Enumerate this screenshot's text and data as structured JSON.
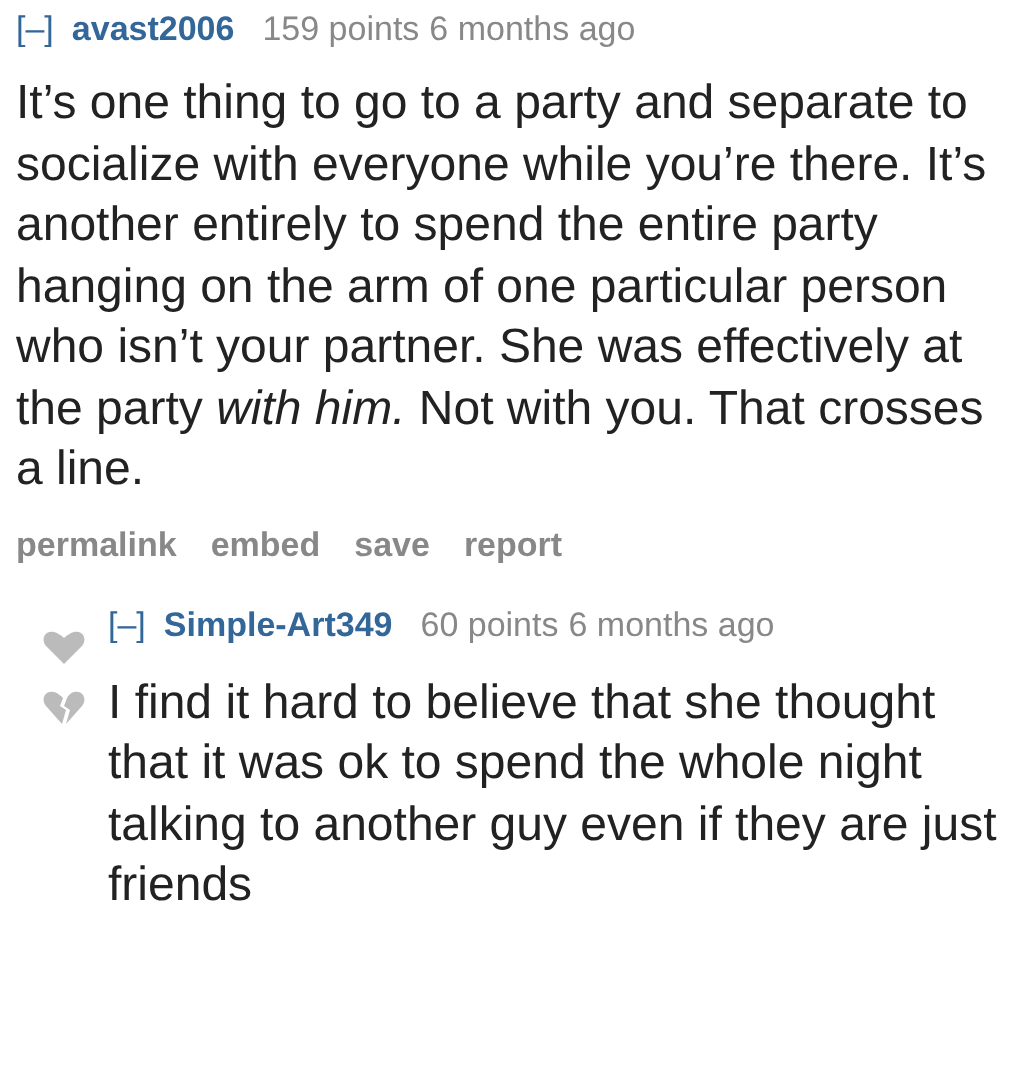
{
  "comments": [
    {
      "toggle": "[–]",
      "author": "avast2006",
      "points": "159 points",
      "time": "6 months ago",
      "body": "It’s one thing to go to a party and separate to socialize with everyone while you’re there. It’s another entirely to spend the entire party hanging on the arm of one particular person who isn’t your partner. She was effectively at the party *with him.* Not with you. That crosses a line.",
      "actions": [
        "permalink",
        "embed",
        "save",
        "report"
      ],
      "replies": [
        {
          "toggle": "[–]",
          "author": "Simple-Art349",
          "points": "60 points",
          "time": "6 months ago",
          "body": "I find it hard to believe that she thought that it was ok to spend the whole night talking to another guy even if they are just friends"
        }
      ]
    }
  ]
}
